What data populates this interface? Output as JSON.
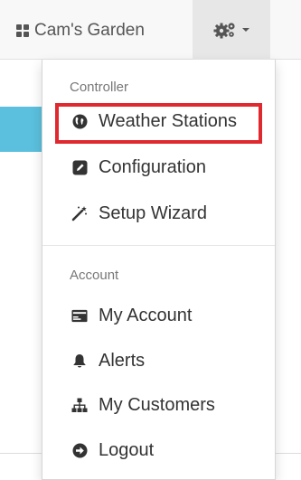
{
  "navbar": {
    "brand_label": "Cam's Garden",
    "brand_icon": "grid-icon",
    "settings_icon": "cogs-icon"
  },
  "dropdown": {
    "controller_header": "Controller",
    "account_header": "Account",
    "controller_items": [
      {
        "label": "Weather Stations",
        "icon": "globe-icon"
      },
      {
        "label": "Configuration",
        "icon": "edit-icon"
      },
      {
        "label": "Setup Wizard",
        "icon": "magic-wand-icon"
      }
    ],
    "account_items": [
      {
        "label": "My Account",
        "icon": "credit-card-icon"
      },
      {
        "label": "Alerts",
        "icon": "bell-icon"
      },
      {
        "label": "My Customers",
        "icon": "sitemap-icon"
      },
      {
        "label": "Logout",
        "icon": "logout-icon"
      }
    ]
  },
  "colors": {
    "highlight": "#e0292e",
    "navbar_bg": "#f8f8f8",
    "active_toggle_bg": "#e7e7e7",
    "accent_blue": "#5bc0de"
  }
}
